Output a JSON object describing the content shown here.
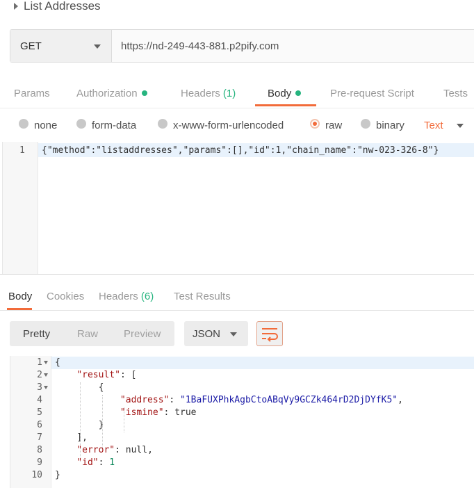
{
  "request": {
    "title": "List Addresses",
    "method": "GET",
    "url": "https://nd-249-443-881.p2pify.com",
    "tabs": [
      {
        "label": "Params"
      },
      {
        "label": "Authorization",
        "dot": true
      },
      {
        "label": "Headers",
        "count": "(1)"
      },
      {
        "label": "Body",
        "dot": true,
        "active": true
      },
      {
        "label": "Pre-request Script"
      },
      {
        "label": "Tests"
      }
    ],
    "body_options": [
      "none",
      "form-data",
      "x-www-form-urlencoded",
      "raw",
      "binary"
    ],
    "body_selected": "raw",
    "body_type": "Text",
    "body_line_number": "1",
    "body_text": "{\"method\":\"listaddresses\",\"params\":[],\"id\":1,\"chain_name\":\"nw-023-326-8\"}"
  },
  "response": {
    "tabs": [
      {
        "label": "Body",
        "active": true
      },
      {
        "label": "Cookies"
      },
      {
        "label": "Headers",
        "count": "(6)"
      },
      {
        "label": "Test Results"
      }
    ],
    "views": [
      "Pretty",
      "Raw",
      "Preview"
    ],
    "view_selected": "Pretty",
    "format": "JSON",
    "wrap_icon": "wrap-lines-icon",
    "lines": [
      "1",
      "2",
      "3",
      "4",
      "5",
      "6",
      "7",
      "8",
      "9",
      "10"
    ],
    "code": {
      "open_brace": "{",
      "result_key": "\"result\"",
      "open_bracket": "[",
      "open_obj": "{",
      "address_key": "\"address\"",
      "address_val": "\"1BaFUXPhkAgbCtoABqVy9GCZk464rD2DjDYfK5\"",
      "ismine_key": "\"ismine\"",
      "ismine_val": "true",
      "close_obj": "}",
      "close_bracket": "],",
      "error_key": "\"error\"",
      "error_val": "null,",
      "id_key": "\"id\"",
      "id_val": "1",
      "close_brace": "}"
    }
  },
  "colors": {
    "accent": "#f26b3a",
    "status_dot": "#26b47f"
  }
}
